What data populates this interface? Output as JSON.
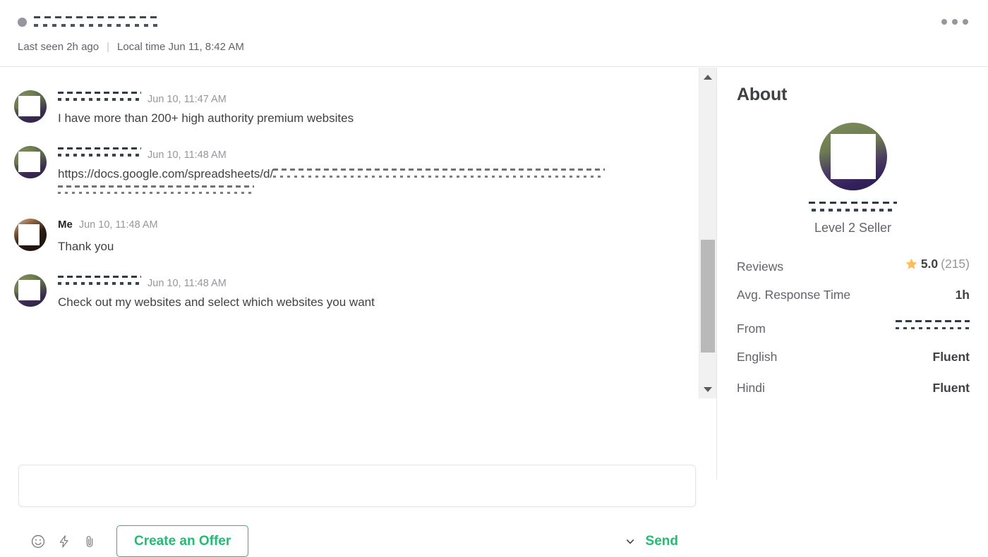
{
  "header": {
    "username": "",
    "username_redacted": true,
    "status": "offline",
    "last_seen": "Last seen 2h ago",
    "separator": "|",
    "local_time": "Local time Jun 11, 8:42 AM",
    "more_menu_label": "More options",
    "more_icon": "ellipsis-horizontal-icon"
  },
  "messages": [
    {
      "author": "",
      "author_redacted": true,
      "time": "Jun 10, 11:47 AM",
      "text": "I have more than 200+ high authority premium websites",
      "avatar": "seller-avatar",
      "is_me": false,
      "is_link": false
    },
    {
      "author": "",
      "author_redacted": true,
      "time": "Jun 10, 11:48 AM",
      "text": "https://docs.google.com/spreadsheets/d/",
      "url_visible": "https://docs.google.com/spreadsheets/d/",
      "avatar": "seller-avatar",
      "is_me": false,
      "is_link": true
    },
    {
      "author": "Me",
      "author_redacted": false,
      "time": "Jun 10, 11:48 AM",
      "text": "Thank you",
      "avatar": "my-avatar",
      "is_me": true,
      "is_link": false
    },
    {
      "author": "",
      "author_redacted": true,
      "time": "Jun 10, 11:48 AM",
      "text": "Check out my websites and select which websites you want",
      "avatar": "seller-avatar",
      "is_me": false,
      "is_link": false
    }
  ],
  "composer": {
    "value": "",
    "placeholder": "",
    "icons": [
      "emoji-icon",
      "quick-response-icon",
      "attachment-icon"
    ],
    "create_offer_label": "Create an Offer",
    "send_label": "Send",
    "send_dropdown_icon": "chevron-down-icon"
  },
  "scrollbar": {
    "up_icon": "caret-up-icon",
    "down_icon": "caret-down-icon",
    "thumb_position_pct": 62
  },
  "about": {
    "title": "About",
    "profile_name": "",
    "profile_name_redacted": true,
    "level": "Level 2 Seller",
    "stats": [
      {
        "label": "Reviews",
        "value": "5.0",
        "count": "(215)",
        "has_star": true,
        "redacted": false
      },
      {
        "label": "Avg. Response Time",
        "value": "1h",
        "has_star": false,
        "redacted": false
      },
      {
        "label": "From",
        "value": "",
        "has_star": false,
        "redacted": true
      },
      {
        "label": "English",
        "value": "Fluent",
        "has_star": false,
        "redacted": false
      },
      {
        "label": "Hindi",
        "value": "Fluent",
        "has_star": false,
        "redacted": false
      }
    ]
  },
  "colors": {
    "brand_green": "#1dbf73",
    "star_gold": "#ffbe5b",
    "text_primary": "#404145",
    "text_secondary": "#62646a",
    "text_muted": "#95979d",
    "border": "#e4e5e7"
  }
}
